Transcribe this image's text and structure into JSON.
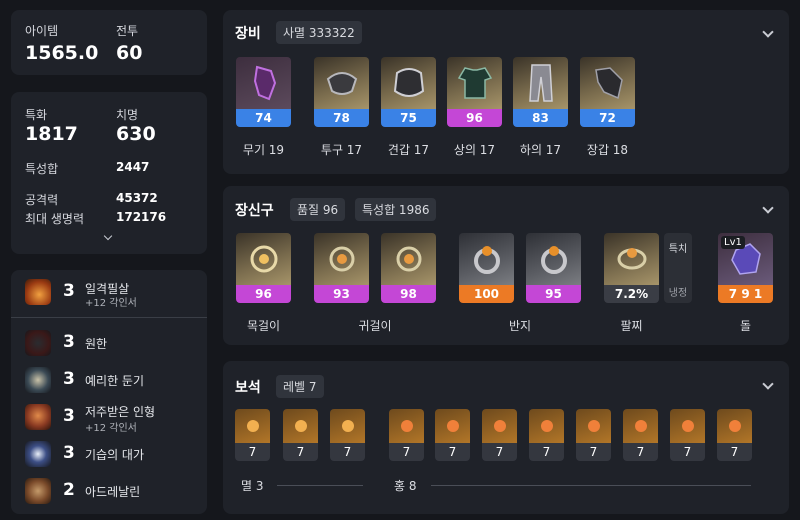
{
  "summary": {
    "item_label": "아이템",
    "item_value": "1565.0",
    "combat_label": "전투",
    "combat_value": "60"
  },
  "stats": {
    "spec_label": "특화",
    "spec_value": "1817",
    "crit_label": "치명",
    "crit_value": "630",
    "total_label": "특성합",
    "total_value": "2447",
    "atk_label": "공격력",
    "atk_value": "45372",
    "hp_label": "최대 생명력",
    "hp_value": "172176"
  },
  "engravings": [
    {
      "level": "3",
      "name": "일격필살",
      "sub": "+12 각인서",
      "color": "#c2571f"
    },
    {
      "level": "3",
      "name": "원한",
      "sub": "",
      "color": "#5a2a28"
    },
    {
      "level": "3",
      "name": "예리한 둔기",
      "sub": "",
      "color": "#3b4a55"
    },
    {
      "level": "3",
      "name": "저주받은 인형",
      "sub": "+12 각인서",
      "color": "#8a3a22"
    },
    {
      "level": "3",
      "name": "기습의 대가",
      "sub": "",
      "color": "#3d4f86"
    },
    {
      "level": "2",
      "name": "아드레날린",
      "sub": "",
      "color": "#7a4a2a"
    }
  ],
  "equipment": {
    "title": "장비",
    "set_label": "사멸 333322",
    "items": [
      {
        "quality": "74",
        "label": "무기 19",
        "bar": "blue",
        "bg": "purple"
      },
      {
        "quality": "78",
        "label": "투구 17",
        "bar": "blue",
        "bg": "gold"
      },
      {
        "quality": "75",
        "label": "견갑 17",
        "bar": "blue",
        "bg": "gold"
      },
      {
        "quality": "96",
        "label": "상의 17",
        "bar": "pink",
        "bg": "gold"
      },
      {
        "quality": "83",
        "label": "하의 17",
        "bar": "blue",
        "bg": "gold"
      },
      {
        "quality": "72",
        "label": "장갑 18",
        "bar": "blue",
        "bg": "gold"
      }
    ]
  },
  "accessories": {
    "title": "장신구",
    "quality_label": "품질 96",
    "total_label": "특성합 1986",
    "items": [
      {
        "quality": "96",
        "bar": "pink",
        "bg": "gold"
      },
      {
        "quality": "93",
        "bar": "pink",
        "bg": "gold"
      },
      {
        "quality": "98",
        "bar": "pink",
        "bg": "gold"
      },
      {
        "quality": "100",
        "bar": "orange",
        "bg": "grey"
      },
      {
        "quality": "95",
        "bar": "pink",
        "bg": "grey"
      },
      {
        "quality": "7.2%",
        "bar": "grey",
        "bg": "gold"
      }
    ],
    "bracelet_tags": [
      "특치",
      "냉정"
    ],
    "stone": {
      "level": "Lv1",
      "value": "7 9 1"
    },
    "labels": [
      "목걸이",
      "귀걸이",
      "반지",
      "팔찌",
      "돌"
    ]
  },
  "gems": {
    "title": "보석",
    "level_label": "레벨 7",
    "values": [
      "7",
      "7",
      "7",
      "7",
      "7",
      "7",
      "7",
      "7",
      "7",
      "7",
      "7"
    ],
    "group1_label": "멸 3",
    "group2_label": "홍 8"
  },
  "icons": {
    "collapse": "chevron-down-icon",
    "expand": "chevron-down-icon"
  }
}
